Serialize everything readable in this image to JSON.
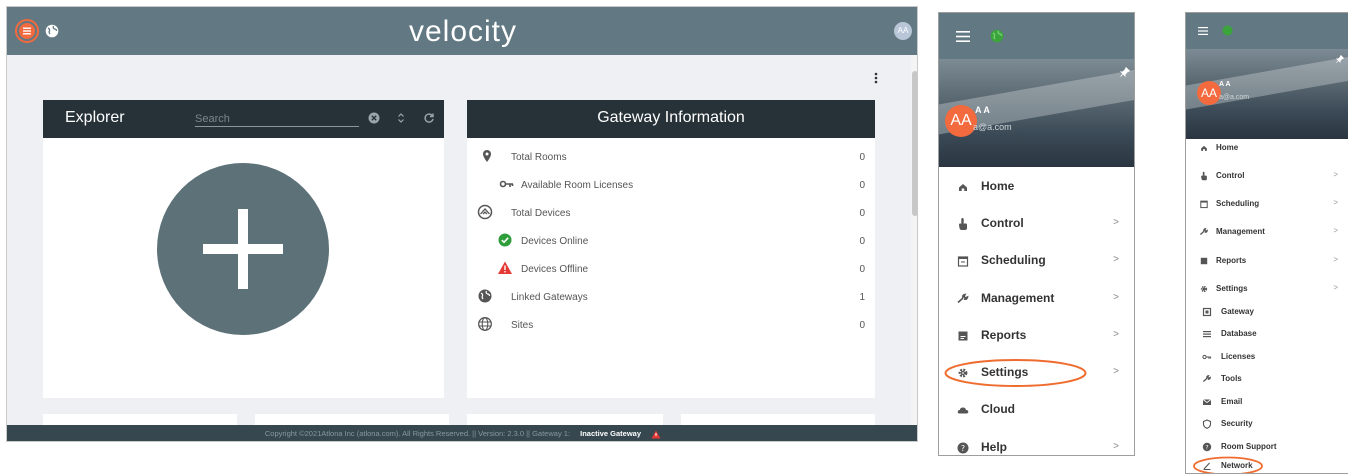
{
  "app": {
    "logo_text": "velocity",
    "avatar_initials": "AA",
    "explorer": {
      "title": "Explorer",
      "search_placeholder": "Search"
    },
    "gateway_info": {
      "title": "Gateway Information",
      "rows": [
        {
          "label": "Total Rooms",
          "value": "0",
          "icon": "map-pin-icon"
        },
        {
          "label": "Available Room Licenses",
          "value": "0",
          "icon": "key-icon"
        },
        {
          "label": "Total Devices",
          "value": "0",
          "icon": "devices-icon"
        },
        {
          "label": "Devices Online",
          "value": "0",
          "icon": "check-circle-icon"
        },
        {
          "label": "Devices Offline",
          "value": "0",
          "icon": "warning-icon"
        },
        {
          "label": "Linked Gateways",
          "value": "1",
          "icon": "globe-icon"
        },
        {
          "label": "Sites",
          "value": "0",
          "icon": "web-icon"
        }
      ]
    },
    "footer": {
      "text": "Copyright ©2021Atlona Inc (atlona.com). All Rights Reserved. || Version: 2.3.0 || Gateway 1:",
      "status": "Inactive Gateway"
    }
  },
  "menu": {
    "user_initials": "AA",
    "user_name": "A A",
    "user_email": "a@a.com",
    "items": [
      {
        "label": "Home",
        "icon": "home-icon",
        "has_children": false
      },
      {
        "label": "Control",
        "icon": "touch-icon",
        "has_children": true
      },
      {
        "label": "Scheduling",
        "icon": "calendar-icon",
        "has_children": true
      },
      {
        "label": "Management",
        "icon": "wrench-icon",
        "has_children": true
      },
      {
        "label": "Reports",
        "icon": "report-icon",
        "has_children": true
      },
      {
        "label": "Settings",
        "icon": "gear-icon",
        "has_children": true
      },
      {
        "label": "Cloud",
        "icon": "cloud-icon",
        "has_children": false
      },
      {
        "label": "Help",
        "icon": "help-icon",
        "has_children": true
      }
    ]
  },
  "menu_expanded": {
    "user_initials": "AA",
    "user_name": "A A",
    "user_email": "a@a.com",
    "items": [
      {
        "label": "Home",
        "has_children": false
      },
      {
        "label": "Control",
        "has_children": true
      },
      {
        "label": "Scheduling",
        "has_children": true
      },
      {
        "label": "Management",
        "has_children": true
      },
      {
        "label": "Reports",
        "has_children": true
      },
      {
        "label": "Settings",
        "has_children": true
      }
    ],
    "settings_children": [
      "Gateway",
      "Database",
      "Licenses",
      "Tools",
      "Email",
      "Security",
      "Room Support",
      "Network"
    ]
  },
  "colors": {
    "header": "#627882",
    "card_header": "#263238",
    "accent_orange": "#f26a3d",
    "globe_green": "#3ba53b",
    "success": "#2e9e3c",
    "danger": "#e53935"
  }
}
